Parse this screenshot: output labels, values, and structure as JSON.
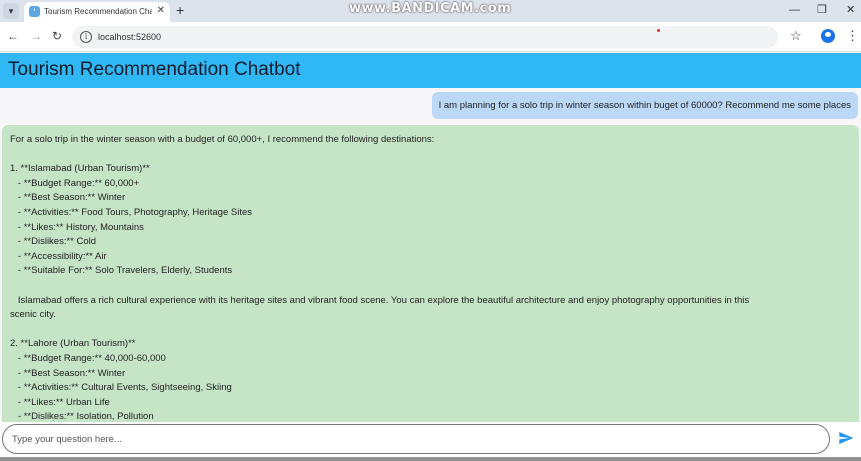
{
  "browser": {
    "tab_title": "Tourism Recommendation Chat",
    "new_tab_glyph": "+",
    "close_glyph": "✕",
    "url": "localhost:52600",
    "watermark": "www.BANDICAM.com"
  },
  "app": {
    "title": "Tourism Recommendation Chatbot",
    "header_color": "#2fb7f6"
  },
  "chat": {
    "user_message": "I am planning for a solo trip in winter season within buget of 60000? Recommend me some places",
    "bot_message_lines": [
      "For a solo trip in the winter season with a budget of 60,000+, I recommend the following destinations:",
      "",
      "1. **Islamabad (Urban Tourism)**",
      "   - **Budget Range:** 60,000+",
      "   - **Best Season:** Winter",
      "   - **Activities:** Food Tours, Photography, Heritage Sites",
      "   - **Likes:** History, Mountains",
      "   - **Dislikes:** Cold",
      "   - **Accessibility:** Air",
      "   - **Suitable For:** Solo Travelers, Elderly, Students",
      "",
      "   Islamabad offers a rich cultural experience with its heritage sites and vibrant food scene. You can explore the beautiful architecture and enjoy photography opportunities in this",
      "scenic city.",
      "",
      "2. **Lahore (Urban Tourism)**",
      "   - **Budget Range:** 40,000-60,000",
      "   - **Best Season:** Winter",
      "   - **Activities:** Cultural Events, Sightseeing, Skiing",
      "   - **Likes:** Urban Life",
      "   - **Dislikes:** Isolation, Pollution"
    ],
    "user_bubble_color": "#bcd8f8",
    "bot_bubble_color": "#c6e5c6"
  },
  "input": {
    "placeholder": "Type your question here...",
    "value": ""
  },
  "icons": {
    "send": "send-icon",
    "back": "back-arrow-icon",
    "forward": "forward-arrow-icon",
    "reload": "reload-icon"
  }
}
